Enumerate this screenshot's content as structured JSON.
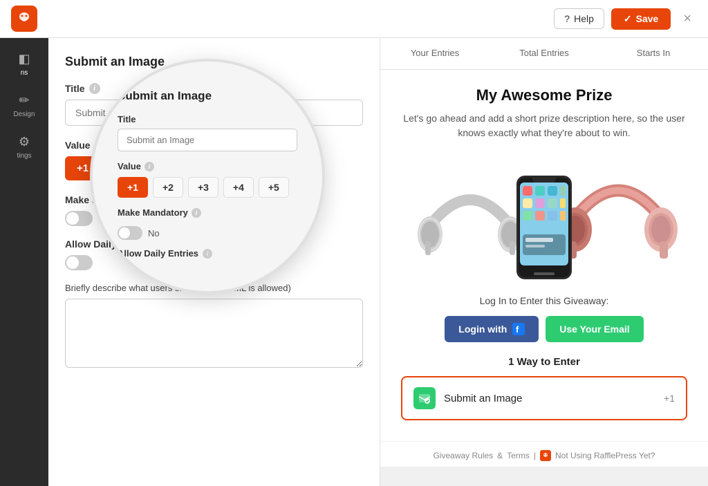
{
  "topbar": {
    "help_label": "Help",
    "save_label": "Save",
    "close_label": "×"
  },
  "sidebar": {
    "items": [
      {
        "id": "ns",
        "label": "ns",
        "icon": "⚙"
      },
      {
        "id": "design",
        "label": "Design",
        "icon": "✏"
      },
      {
        "id": "settings",
        "label": "tings",
        "icon": "⚙"
      }
    ]
  },
  "left_panel": {
    "title": "Submit an Image",
    "title_field_label": "Title",
    "title_placeholder": "Submit an Image",
    "value_label": "Value",
    "value_options": [
      "+1",
      "+2",
      "+3",
      "+4",
      "+5"
    ],
    "value_active": "+1",
    "mandatory_label": "Make Mandatory",
    "mandatory_toggle": "No",
    "daily_entries_label": "Allow Daily Entries",
    "desc_label": "Briefly describe what users should do: (HTML is allowed)",
    "desc_placeholder": ""
  },
  "magnifier": {
    "title": "Submit an Image",
    "title_field_label": "Title",
    "title_placeholder": "Submit an Image",
    "value_label": "Value",
    "value_options": [
      "+1",
      "+2",
      "+3",
      "+4",
      "+5"
    ],
    "value_active_index": 0,
    "mandatory_label": "Make Mandatory",
    "mandatory_toggle_label": "No",
    "daily_label": "Allow Daily Entries"
  },
  "preview": {
    "tabs": [
      {
        "label": "Your Entries"
      },
      {
        "label": "Total Entries"
      },
      {
        "label": "Starts In"
      }
    ],
    "prize_title": "My Awesome Prize",
    "prize_desc": "Let's go ahead and add a short prize description here, so the user knows exactly what they're about to win.",
    "login_prompt": "Log In to Enter this Giveaway:",
    "login_with_label": "Login with",
    "use_email_label": "Use Your Email",
    "ways_label": "1 Way to Enter",
    "entry_label": "Submit an Image",
    "entry_points": "+1",
    "footer_rules": "Giveaway Rules",
    "footer_terms": "Terms",
    "footer_separator": "|",
    "footer_not_using": "Not Using RafflePress Yet?"
  }
}
